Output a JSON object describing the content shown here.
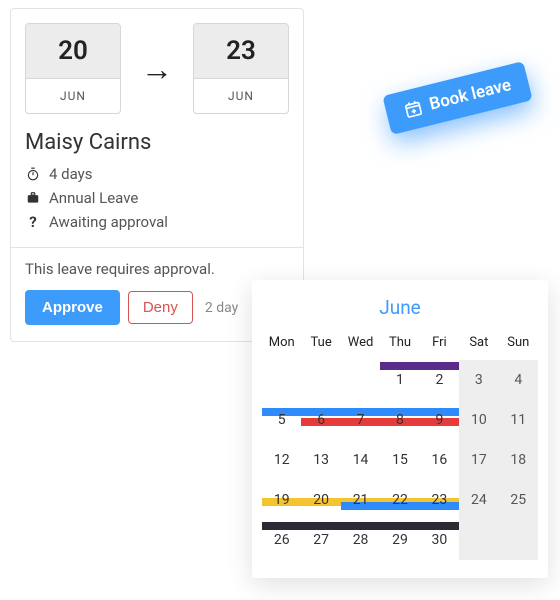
{
  "leave": {
    "start_day": "20",
    "start_month": "JUN",
    "end_day": "23",
    "end_month": "JUN",
    "person": "Maisy Cairns",
    "duration": "4 days",
    "type": "Annual Leave",
    "status": "Awaiting approval",
    "approval_note": "This leave requires approval.",
    "approve_label": "Approve",
    "deny_label": "Deny",
    "trailing": "2 day"
  },
  "book_leave_label": "Book leave",
  "calendar": {
    "month": "June",
    "weekdays": [
      "Mon",
      "Tue",
      "Wed",
      "Thu",
      "Fri",
      "Sat",
      "Sun"
    ],
    "rows": [
      [
        "",
        "",
        "",
        "1",
        "2",
        "3",
        "4"
      ],
      [
        "5",
        "6",
        "7",
        "8",
        "9",
        "10",
        "11"
      ],
      [
        "12",
        "13",
        "14",
        "15",
        "16",
        "17",
        "18"
      ],
      [
        "19",
        "20",
        "21",
        "22",
        "23",
        "24",
        "25"
      ],
      [
        "26",
        "27",
        "28",
        "29",
        "30",
        "",
        ""
      ]
    ],
    "bars": [
      {
        "row": 0,
        "start": 3,
        "end": 5,
        "offset": 2,
        "color": "#5b2b8a"
      },
      {
        "row": 1,
        "start": 0,
        "end": 5,
        "offset": 8,
        "color": "#2f8bfb"
      },
      {
        "row": 1,
        "start": 1,
        "end": 5,
        "offset": 18,
        "color": "#e63b3b"
      },
      {
        "row": 3,
        "start": 0,
        "end": 5,
        "offset": 18,
        "color": "#f4c430"
      },
      {
        "row": 3,
        "start": 2,
        "end": 5,
        "offset": 22,
        "color": "#2f8bfb"
      },
      {
        "row": 4,
        "start": 0,
        "end": 5,
        "offset": 2,
        "color": "#2b2b36"
      }
    ]
  }
}
